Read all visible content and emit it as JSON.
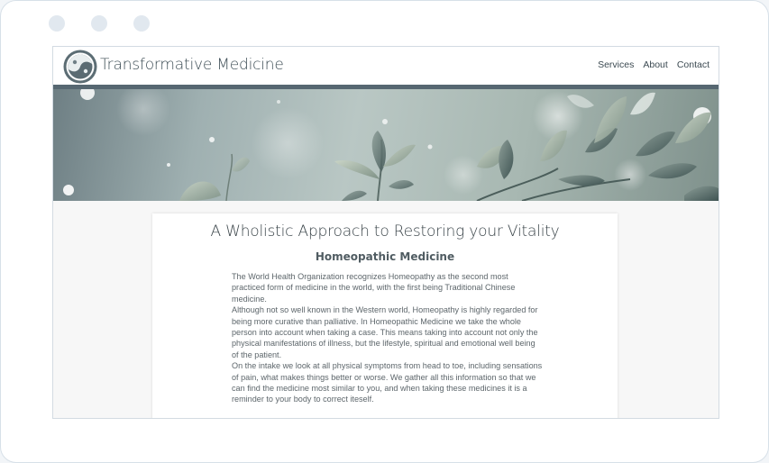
{
  "site": {
    "brand": "Transformative Medicine",
    "logo_icon": "swirl-logo-icon"
  },
  "nav": {
    "items": [
      {
        "label": "Services"
      },
      {
        "label": "About"
      },
      {
        "label": "Contact"
      }
    ]
  },
  "hero": {
    "image": "green-leaves-bokeh-photo"
  },
  "content": {
    "title": "A Wholistic Approach to Restoring your Vitality",
    "subtitle": "Homeopathic Medicine",
    "paragraphs": [
      "The World Health Organization recognizes Homeopathy as the second most practiced form of medicine in the world, with the first being Traditional Chinese medicine.",
      "Although not so well known in the Western world, Homeopathy is highly regarded for being more curative than palliative. In Homeopathic Medicine we take the whole person into account when taking a case. This means taking into account not only the physical manifestations of illness, but the lifestyle, spiritual and emotional well being of the patient.",
      "On the intake we look at all physical symptoms from head to toe, including sensations of pain, what makes things better or worse. We gather all this information so that we can find the medicine most similar to you, and when taking these medicines it is a reminder to your body to correct iteself."
    ]
  },
  "colors": {
    "header_bar": "#566771",
    "brand_text": "#3d4d55",
    "logo_ring": "#5c6d74"
  }
}
